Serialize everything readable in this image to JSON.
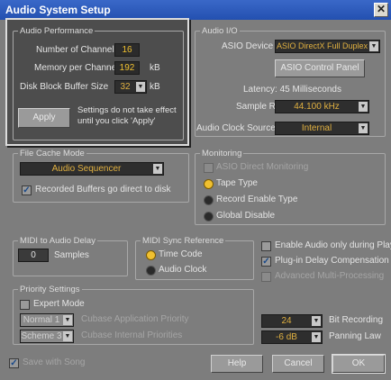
{
  "window": {
    "title": "Audio System Setup",
    "close_glyph": "✕"
  },
  "audio_performance": {
    "legend": "Audio Performance",
    "channels_label": "Number of Channels",
    "channels_value": "16",
    "memory_label": "Memory per Channel",
    "memory_value": "192",
    "memory_unit": "kB",
    "disk_label": "Disk Block Buffer Size",
    "disk_value": "32",
    "disk_unit": "kB",
    "apply_label": "Apply",
    "note": "Settings do not take effect until you click 'Apply'"
  },
  "audio_io": {
    "legend": "Audio I/O",
    "asio_device_label": "ASIO Device",
    "asio_device_value": "ASIO DirectX Full Duplex",
    "asio_control_panel_label": "ASIO Control Panel",
    "latency": "Latency: 45 Milliseconds",
    "sample_rate_label": "Sample Rate",
    "sample_rate_value": "44.100 kHz",
    "clock_source_label": "Audio Clock Source",
    "clock_source_value": "Internal"
  },
  "file_cache": {
    "legend": "File Cache Mode",
    "mode_value": "Audio Sequencer",
    "recorded_buffers_label": "Recorded Buffers go direct to disk",
    "recorded_buffers_checked": true
  },
  "monitoring": {
    "legend": "Monitoring",
    "asio_direct_label": "ASIO Direct Monitoring",
    "asio_direct_checked": false,
    "options": [
      {
        "label": "Tape Type",
        "selected": true
      },
      {
        "label": "Record Enable Type",
        "selected": false
      },
      {
        "label": "Global Disable",
        "selected": false
      }
    ]
  },
  "midi_audio_delay": {
    "legend": "MIDI to Audio Delay",
    "value": "0",
    "unit": "Samples"
  },
  "midi_sync": {
    "legend": "MIDI Sync Reference",
    "options": [
      {
        "label": "Time Code",
        "selected": true
      },
      {
        "label": "Audio Clock",
        "selected": false
      }
    ]
  },
  "right_options": [
    {
      "label": "Enable Audio only during Play",
      "checked": false,
      "enabled": true
    },
    {
      "label": "Plug-in Delay Compensation",
      "checked": true,
      "enabled": true
    },
    {
      "label": "Advanced Multi-Processing",
      "checked": false,
      "enabled": false
    }
  ],
  "priority": {
    "legend": "Priority Settings",
    "expert_mode_label": "Expert Mode",
    "expert_mode_checked": false,
    "app_priority_value": "Normal 1",
    "app_priority_label": "Cubase Application Priority",
    "internal_priority_value": "Scheme 3",
    "internal_priority_label": "Cubase Internal Priorities"
  },
  "bit_recording": {
    "value": "24",
    "label": "Bit Recording"
  },
  "panning_law": {
    "value": "-6 dB",
    "label": "Panning Law"
  },
  "footer": {
    "save_with_song_label": "Save with Song",
    "save_with_song_checked": true,
    "help_label": "Help",
    "cancel_label": "Cancel",
    "ok_label": "OK"
  }
}
